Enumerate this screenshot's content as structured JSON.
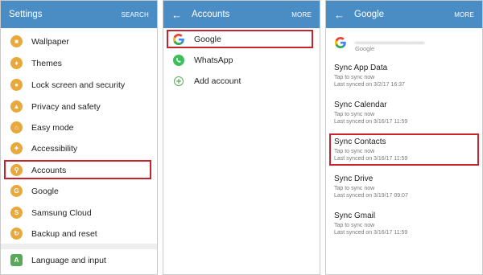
{
  "settings": {
    "title": "Settings",
    "action": "SEARCH",
    "items": [
      {
        "label": "Wallpaper",
        "icon": "wallpaper-icon",
        "color": "#e8a83b"
      },
      {
        "label": "Themes",
        "icon": "themes-icon",
        "color": "#e8a83b"
      },
      {
        "label": "Lock screen and security",
        "icon": "lock-icon",
        "color": "#e8a83b"
      },
      {
        "label": "Privacy and safety",
        "icon": "privacy-icon",
        "color": "#e8a83b"
      },
      {
        "label": "Easy mode",
        "icon": "easy-mode-icon",
        "color": "#e8a83b"
      },
      {
        "label": "Accessibility",
        "icon": "accessibility-icon",
        "color": "#e8a83b"
      },
      {
        "label": "Accounts",
        "icon": "key-icon",
        "color": "#e8a83b"
      },
      {
        "label": "Google",
        "icon": "google-icon",
        "color": "#e8a83b"
      },
      {
        "label": "Samsung Cloud",
        "icon": "samsung-cloud-icon",
        "color": "#e8a83b"
      },
      {
        "label": "Backup and reset",
        "icon": "backup-icon",
        "color": "#e8a83b"
      },
      {
        "label": "Language and input",
        "icon": "language-icon",
        "color": "#5aa85a"
      }
    ]
  },
  "accounts": {
    "title": "Accounts",
    "action": "MORE",
    "items": [
      {
        "label": "Google",
        "icon": "google-icon"
      },
      {
        "label": "WhatsApp",
        "icon": "whatsapp-icon"
      },
      {
        "label": "Add account",
        "icon": "add-icon"
      }
    ]
  },
  "google": {
    "title": "Google",
    "action": "MORE",
    "account_type": "Google",
    "sync_items": [
      {
        "title": "Sync App Data",
        "status": "Tap to sync now",
        "last": "Last synced on 3/2/17 16:37"
      },
      {
        "title": "Sync Calendar",
        "status": "Tap to sync now",
        "last": "Last synced on 3/16/17 11:59"
      },
      {
        "title": "Sync Contacts",
        "status": "Tap to sync now",
        "last": "Last synced on 3/16/17 11:59"
      },
      {
        "title": "Sync Drive",
        "status": "Tap to sync now",
        "last": "Last synced on 3/19/17 09:07"
      },
      {
        "title": "Sync Gmail",
        "status": "Tap to sync now",
        "last": "Last synced on 3/16/17 11:59"
      }
    ]
  },
  "colors": {
    "appbar": "#4a8cc4",
    "highlight": "#c8232a"
  }
}
